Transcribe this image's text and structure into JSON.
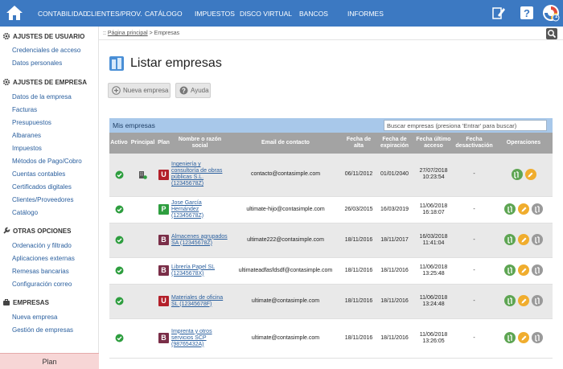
{
  "topnav": {
    "items": [
      "CONTABILIDAD",
      "CLIENTES/PROV.",
      "CATÁLOGO",
      "IMPUESTOS",
      "DISCO VIRTUAL",
      "BANCOS",
      "INFORMES"
    ],
    "notification_count": "1",
    "bar_color": "#3c79c2"
  },
  "sidebar": {
    "sections": [
      {
        "title": "AJUSTES DE USUARIO",
        "icon": "gear-icon",
        "links": [
          "Credenciales de acceso",
          "Datos personales"
        ]
      },
      {
        "title": "AJUSTES DE EMPRESA",
        "icon": "gear-icon",
        "links": [
          "Datos de la empresa",
          "Facturas",
          "Presupuestos",
          "Albaranes",
          "Impuestos",
          "Métodos de Pago/Cobro",
          "Cuentas contables",
          "Certificados digitales",
          "Clientes/Proveedores",
          "Catálogo"
        ]
      },
      {
        "title": "OTRAS OPCIONES",
        "icon": "wrench-icon",
        "links": [
          "Ordenación y filtrado",
          "Aplicaciones externas",
          "Remesas bancarias",
          "Configuración correo"
        ]
      },
      {
        "title": "EMPRESAS",
        "icon": "briefcase-icon",
        "links": [
          "Nueva empresa",
          "Gestión de empresas"
        ]
      }
    ],
    "plan_label": "Plan"
  },
  "breadcrumb": {
    "prefix": "::",
    "home": "Página principal",
    "separator": ">",
    "current": "Empresas"
  },
  "page": {
    "title": "Listar empresas",
    "new_button": "Nueva empresa",
    "help_button": "Ayuda"
  },
  "panel": {
    "title": "Mis empresas",
    "search_placeholder": "Buscar empresas (presiona 'Entrar' para buscar)",
    "columns": [
      "Activo",
      "Principal",
      "Plan",
      "Nombre o razón social",
      "Email de contacto",
      "Fecha de alta",
      "Fecha de expiración",
      "Fecha último acceso",
      "Fecha desactivación",
      "Operaciones"
    ],
    "rows": [
      {
        "active": true,
        "principal": true,
        "plan": "U",
        "plan_color": "#b3202a",
        "name": "Ingeniería y consultoría de obras públicas S.L. (12345678Z)",
        "email": "contacto@contasimple.com",
        "alta": "06/11/2012",
        "expiracion": "01/01/2040",
        "ultimo_acceso": "27/07/2018 10:23:54",
        "desactivacion": "-",
        "ops": [
          "green",
          "yellow"
        ]
      },
      {
        "active": true,
        "principal": false,
        "plan": "P",
        "plan_color": "#2e9e3f",
        "name": "Jose García Hernández (12345678Z)",
        "email": "ultimate-hijo@contasimple.com",
        "alta": "26/03/2015",
        "expiracion": "16/03/2019",
        "ultimo_acceso": "11/06/2018 16:18:07",
        "desactivacion": "-",
        "ops": [
          "green",
          "yellow",
          "gray"
        ]
      },
      {
        "active": true,
        "principal": false,
        "plan": "B",
        "plan_color": "#7a2e48",
        "name": "Almacenes agrupados SA (12345678Z)",
        "email": "ultimate222@contasimple.com",
        "alta": "18/11/2016",
        "expiracion": "18/11/2017",
        "ultimo_acceso": "16/03/2018 11:41:04",
        "desactivacion": "-",
        "ops": [
          "green",
          "yellow",
          "gray"
        ]
      },
      {
        "active": true,
        "principal": false,
        "plan": "B",
        "plan_color": "#7a2e48",
        "name": "Librería Papel SL (12345678X)",
        "email": "ultimateadfasfdsdf@contasimple.com",
        "alta": "18/11/2016",
        "expiracion": "18/11/2016",
        "ultimo_acceso": "11/06/2018 13:25:48",
        "desactivacion": "-",
        "ops": [
          "green",
          "yellow",
          "gray"
        ]
      },
      {
        "active": true,
        "principal": false,
        "plan": "U",
        "plan_color": "#b3202a",
        "name": "Materiales de oficina SL (12345678F)",
        "email": "ultimate@contasimple.com",
        "alta": "18/11/2016",
        "expiracion": "18/11/2016",
        "ultimo_acceso": "11/06/2018 13:24:48",
        "desactivacion": "-",
        "ops": [
          "green",
          "yellow",
          "gray"
        ]
      },
      {
        "active": true,
        "principal": false,
        "plan": "B",
        "plan_color": "#7a2e48",
        "name": "Imprenta y otros servicios SCP (98765432A)",
        "email": "ultimate@contasimple.com",
        "alta": "18/11/2016",
        "expiracion": "18/11/2016",
        "ultimo_acceso": "11/06/2018 13:26:05",
        "desactivacion": "-",
        "ops": [
          "green",
          "yellow",
          "gray"
        ]
      }
    ]
  }
}
